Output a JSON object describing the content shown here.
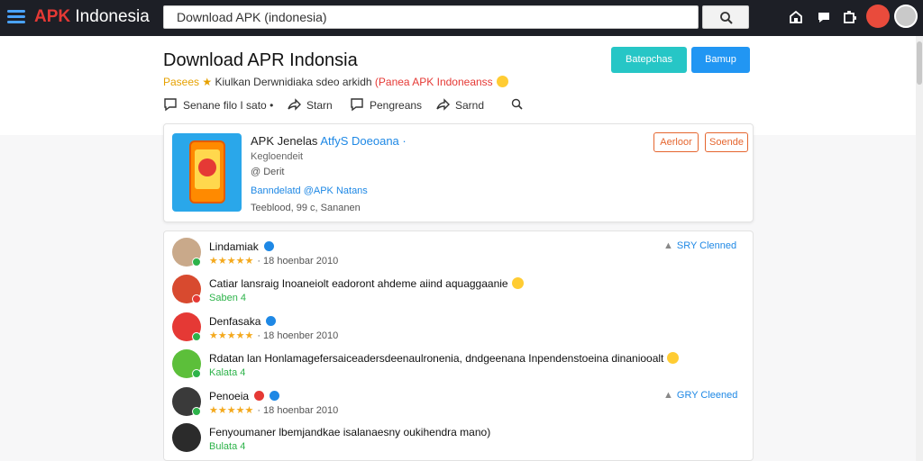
{
  "header": {
    "logo_apk": "APK",
    "logo_name": "Indonesia",
    "search_value": "Download APK (indonesia)"
  },
  "page": {
    "title": "Download APR Indonsia",
    "button_primary": "Batepchas",
    "button_secondary": "Bamup",
    "sub_tag": "Pasees ★",
    "sub_text": "Kiulkan Derwnidiaka sdeo arkidh",
    "sub_red": "(Panea APK Indoneanss",
    "actions": [
      "Senane filo I sato •",
      "Starn",
      "Pengreans",
      "Sarnd"
    ]
  },
  "app": {
    "name": "APK Jenelas",
    "name_blue": "AtfyS  Doeoana ·",
    "developer": "Kegloendeit",
    "size": "@ Derit",
    "link": "Banndelatd @APK Natans",
    "meta": "Teeblood, 99 c, Sananen",
    "btn_left": "Aerloor",
    "btn_right": "Soende"
  },
  "comments": [
    {
      "name": "Lindamiak",
      "stars": "★★★★★",
      "date": "· 18 hoenbar 2010",
      "right": "SRY Clenned"
    },
    {
      "text": "Catiar lansraig Inoaneiolt eadoront ahdeme aiind aquaggaanie",
      "reply": "Saben 4"
    },
    {
      "name": "Denfasaka",
      "stars": "★★★★★",
      "date": "· 18 hoenber 2010"
    },
    {
      "text": "Rdatan lan Honlamagefersaiceadersdeenaulronenia, dndgeenana Inpendenstoeina dinaniooalt",
      "reply": "Kalata 4"
    },
    {
      "name": "Penoeia",
      "stars": "★★★★★",
      "date": "· 18 hoenbar 2010",
      "right": "GRY Cleened"
    },
    {
      "text": "Fenyoumaner lbemjandkae isalanaesny oukihendra mano)",
      "reply": "Bulata 4"
    }
  ]
}
